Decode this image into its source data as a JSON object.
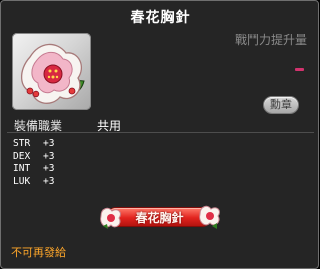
{
  "tooltip": {
    "title": "春花胸針",
    "power_label": "戰鬥力提升量",
    "medal_label": "勳章",
    "job_label": "裝備職業",
    "job_value": "共用",
    "stats": [
      {
        "name": "STR",
        "value": "+3"
      },
      {
        "name": "DEX",
        "value": "+3"
      },
      {
        "name": "INT",
        "value": "+3"
      },
      {
        "name": "LUK",
        "value": "+3"
      }
    ],
    "set_name": "春花胸針",
    "trade_note": "不可再發給"
  },
  "icons": {
    "item": "spring-flower-brooch-icon",
    "set_banner": "blossom-banner-icon"
  },
  "colors": {
    "background": "#252525",
    "border": "#6f6f6f",
    "power_dash": "#d2336e",
    "trade_note": "#ffa72a",
    "banner_red": "#e2231e"
  }
}
